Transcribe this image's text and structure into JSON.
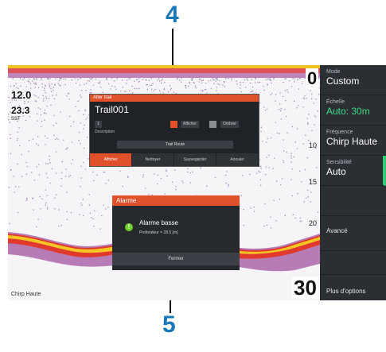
{
  "callouts": {
    "top": "4",
    "bottom": "5"
  },
  "sonar": {
    "depth_primary": "12.0",
    "depth_secondary": "23.3",
    "depth_secondary_unit": "SST",
    "range_top": "0",
    "range_bottom": "30",
    "scale_marks": [
      "10",
      "15",
      "20"
    ],
    "frequency_label": "Chirp Haute"
  },
  "menu": {
    "items": [
      {
        "caption": "Mode",
        "value": "Custom"
      },
      {
        "caption": "Échelle",
        "value": "Auto: 30m"
      },
      {
        "caption": "Fréquence",
        "value": "Chirp Haute"
      },
      {
        "caption": "Sensibilité",
        "value": "Auto"
      },
      {
        "label": "Avancé"
      },
      {
        "label": "Plus d'options"
      }
    ]
  },
  "trail_dialog": {
    "header": "Aller trail",
    "name": "Trail001",
    "sub": "Description",
    "chip_left": "1",
    "chip_mid": "Afficher",
    "chip_right": "Ombrer",
    "wide_button": "Trail Route",
    "tabs": [
      "Afficher",
      "Nettoyer",
      "Sauvegarder",
      "Annuler"
    ]
  },
  "alarm_dialog": {
    "header": "Alarme",
    "title": "Alarme basse",
    "detail": "Profondeur = 28.5 [m]",
    "button": "Fermer"
  },
  "colors": {
    "accent": "#e0502a",
    "callout": "#1a78b8",
    "menu_bg": "#2b2e33",
    "active_value": "#3ddc84"
  }
}
